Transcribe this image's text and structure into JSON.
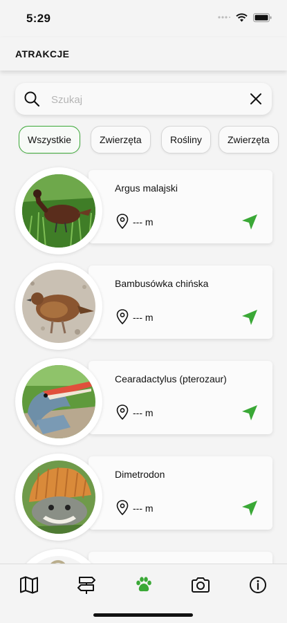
{
  "status_bar": {
    "time": "5:29"
  },
  "header": {
    "title": "ATRAKCJE"
  },
  "search": {
    "placeholder": "Szukaj",
    "value": ""
  },
  "filters": [
    {
      "label": "Wszystkie",
      "active": true
    },
    {
      "label": "Zwierzęta",
      "active": false
    },
    {
      "label": "Rośliny",
      "active": false
    },
    {
      "label": "Zwierzęta",
      "active": false
    }
  ],
  "attractions": [
    {
      "name": "Argus malajski",
      "distance": "--- m",
      "image": "bird-in-grass"
    },
    {
      "name": "Bambusówka chińska",
      "distance": "--- m",
      "image": "partridge-on-gravel"
    },
    {
      "name": "Cearadactylus (pterozaur)",
      "distance": "--- m",
      "image": "pterosaur-model"
    },
    {
      "name": "Dimetrodon",
      "distance": "--- m",
      "image": "dimetrodon-model"
    },
    {
      "name": "",
      "distance": "",
      "image": "partial-item"
    }
  ],
  "tab_bar": {
    "tabs": [
      {
        "icon": "map-icon",
        "active": false
      },
      {
        "icon": "signpost-icon",
        "active": false
      },
      {
        "icon": "paw-icon",
        "active": true
      },
      {
        "icon": "camera-icon",
        "active": false
      },
      {
        "icon": "info-icon",
        "active": false
      }
    ]
  },
  "colors": {
    "accent": "#3aa836",
    "background": "#f4f4f4",
    "card": "#fbfbfb"
  }
}
